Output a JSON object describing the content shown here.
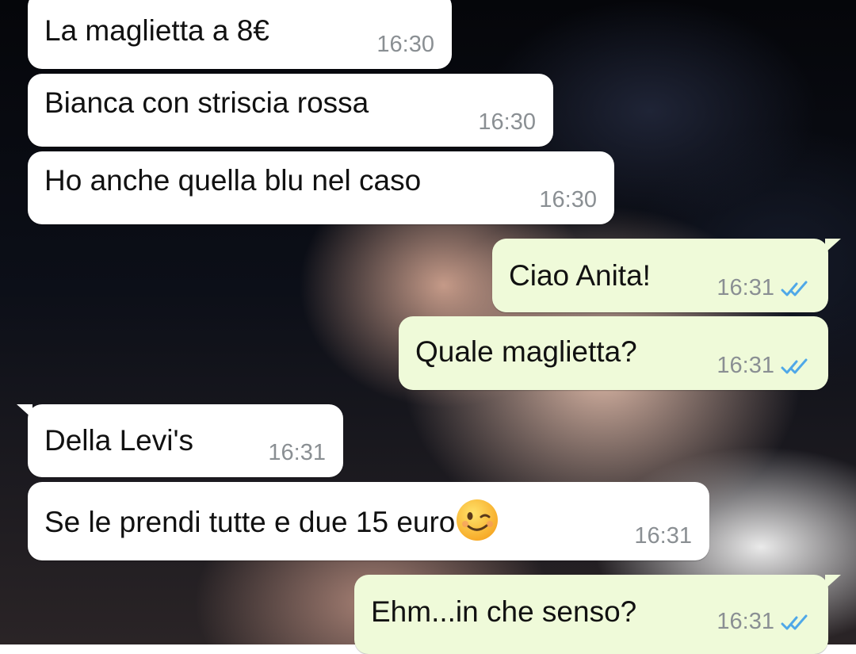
{
  "chat": {
    "messages": [
      {
        "direction": "incoming",
        "text": "La maglietta a 8€",
        "time": "16:30"
      },
      {
        "direction": "incoming",
        "text": "Bianca con striscia rossa",
        "time": "16:30"
      },
      {
        "direction": "incoming",
        "text": "Ho anche quella blu nel caso",
        "time": "16:30"
      },
      {
        "direction": "outgoing",
        "text": "Ciao Anita!",
        "time": "16:31",
        "status": "read"
      },
      {
        "direction": "outgoing",
        "text": "Quale maglietta?",
        "time": "16:31",
        "status": "read"
      },
      {
        "direction": "incoming",
        "text": "Della Levi's",
        "time": "16:31"
      },
      {
        "direction": "incoming",
        "text": "Se le prendi tutte e due 15 euro",
        "emoji": "winking-face",
        "time": "16:31"
      },
      {
        "direction": "outgoing",
        "text": "Ehm...in che senso?",
        "time": "16:31",
        "status": "read"
      }
    ]
  },
  "colors": {
    "incoming_bubble": "#ffffff",
    "outgoing_bubble": "#effad9",
    "read_ticks": "#4fa8e8",
    "timestamp": "#8a8f93"
  },
  "icons": {
    "read_receipt": "double-check-icon",
    "emoji": "winking-face-emoji"
  }
}
